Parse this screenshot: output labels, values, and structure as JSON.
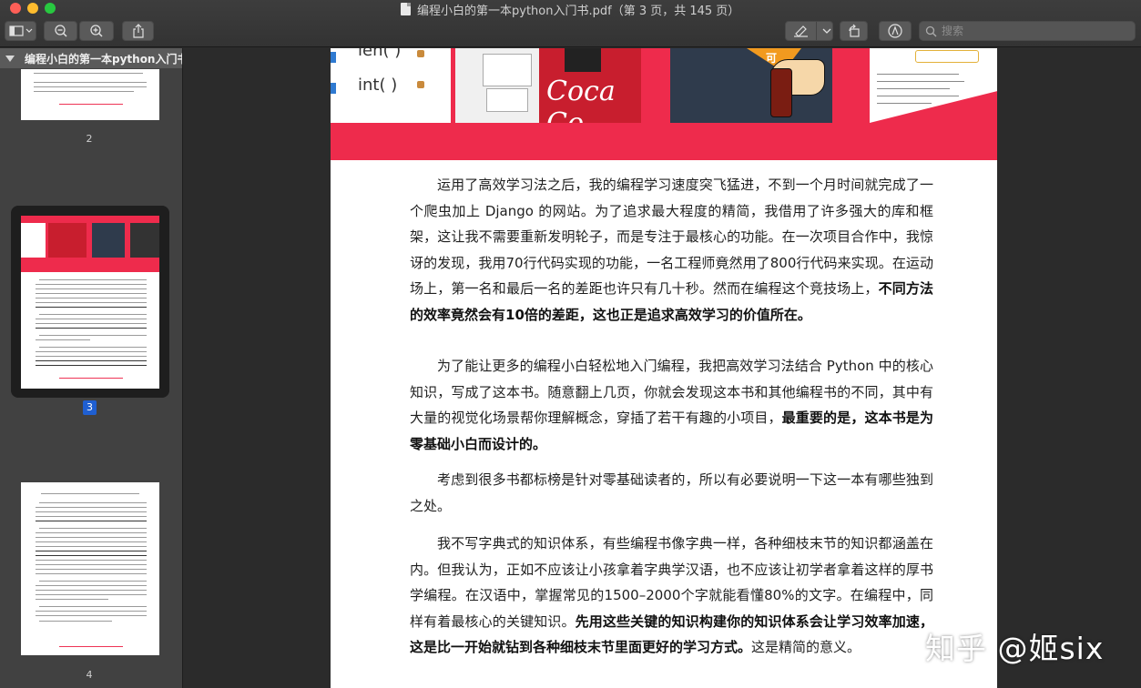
{
  "window": {
    "title": "编程小白的第一本python入门书.pdf（第 3 页，共 145 页）"
  },
  "toolbar": {
    "search_placeholder": "搜索"
  },
  "sidebar": {
    "doc_title": "编程小白的第一本python入门书.pdf",
    "pages": [
      {
        "number": "2"
      },
      {
        "number": "3"
      },
      {
        "number": "4"
      }
    ]
  },
  "page": {
    "cover_snippets": {
      "code1": "len(   )",
      "code2": "int(   )",
      "card2_text": "Coca Co",
      "card3_text": "可"
    },
    "p1": {
      "text": "运用了高效学习法之后，我的编程学习速度突飞猛进，不到一个月时间就完成了一个爬虫加上 Django 的网站。为了追求最大程度的精简，我借用了许多强大的库和框架，这让我不需要重新发明轮子，而是专注于最核心的功能。在一次项目合作中，我惊讶的发现，我用70行代码实现的功能，一名工程师竟然用了800行代码来实现。在运动场上，第一名和最后一名的差距也许只有几十秒。然而在编程这个竞技场上，",
      "bold": "不同方法的效率竟然会有10倍的差距，这也正是追求高效学习的价值所在。"
    },
    "p2": {
      "text": "为了能让更多的编程小白轻松地入门编程，我把高效学习法结合 Python 中的核心知识，写成了这本书。随意翻上几页，你就会发现这本书和其他编程书的不同，其中有大量的视觉化场景帮你理解概念，穿插了若干有趣的小项目，",
      "bold": "最重要的是，这本书是为零基础小白而设计的。"
    },
    "p3": {
      "text": "考虑到很多书都标榜是针对零基础读者的，所以有必要说明一下这一本有哪些独到之处。"
    },
    "p4": {
      "text": "我不写字典式的知识体系，有些编程书像字典一样，各种细枝末节的知识都涵盖在内。但我认为，正如不应该让小孩拿着字典学汉语，也不应该让初学者拿着这样的厚书学编程。在汉语中，掌握常见的1500–2000个字就能看懂80%的文字。在编程中，同样有着最核心的关键知识。",
      "bold": "先用这些关键的知识构建你的知识体系会让学习效率加速，这是比一开始就钻到各种细枝末节里面更好的学习方式。",
      "tail": "这是精简的意义。"
    }
  },
  "watermark": "知乎 @姬six"
}
